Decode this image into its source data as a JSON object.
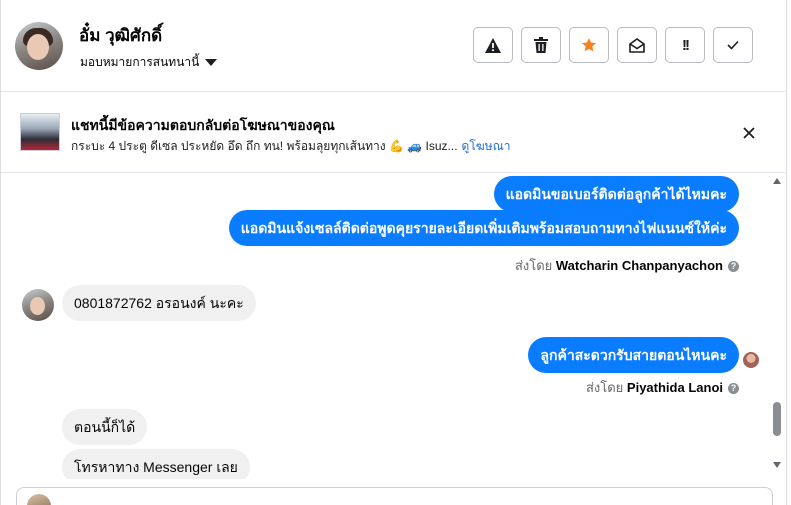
{
  "header": {
    "contact_name": "อั๋ม วุฒิศักดิ์",
    "assign_label": "มอบหมายการสนทนานี้",
    "toolbar": [
      {
        "name": "report-button",
        "icon": "warning-triangle-icon"
      },
      {
        "name": "delete-button",
        "icon": "trash-icon"
      },
      {
        "name": "star-button",
        "icon": "star-icon",
        "color": "#f5821f"
      },
      {
        "name": "mark-unread-button",
        "icon": "envelope-open-icon"
      },
      {
        "name": "mark-important-button",
        "icon": "exclamation-icon",
        "glyph": "!!"
      },
      {
        "name": "mark-done-button",
        "icon": "checkmark-icon"
      }
    ]
  },
  "ad_banner": {
    "title": "แชทนี้มีข้อความตอบกลับต่อโฆษณาของคุณ",
    "subtitle": "กระบะ 4 ประตู ดีเซล ประหยัด อึด ถึก ทน! พร้อมลุยทุกเส้นทาง 💪 🚙 Isuz...",
    "link_label": "ดูโฆษณา"
  },
  "messages": {
    "m1": "แอดมินขอเบอร์ติดต่อลูกค้าได้ไหมคะ",
    "m2": "แอดมินแจ้งเซลล์ติดต่อพูดคุยรายละเอียดเพิ่มเติมพร้อมสอบถามทางไฟแนนซ์ให้ค่ะ",
    "sent_by_1_prefix": "ส่งโดย",
    "sent_by_1_name": "Watcharin Chanpanyachon",
    "m3": "0801872762 อรอนงค์ นะคะ",
    "m4": "ลูกค้าสะดวกรับสายตอนไหนคะ",
    "sent_by_2_prefix": "ส่งโดย",
    "sent_by_2_name": "Piyathida Lanoi",
    "m5": "ตอนนี้ก็ได้",
    "m6": "โทรหาทาง Messenger เลย",
    "help_glyph": "?"
  },
  "colors": {
    "outgoing_bubble": "#0a7cff",
    "incoming_bubble": "#f0f0f0",
    "link": "#216fdb",
    "star": "#f5821f"
  }
}
